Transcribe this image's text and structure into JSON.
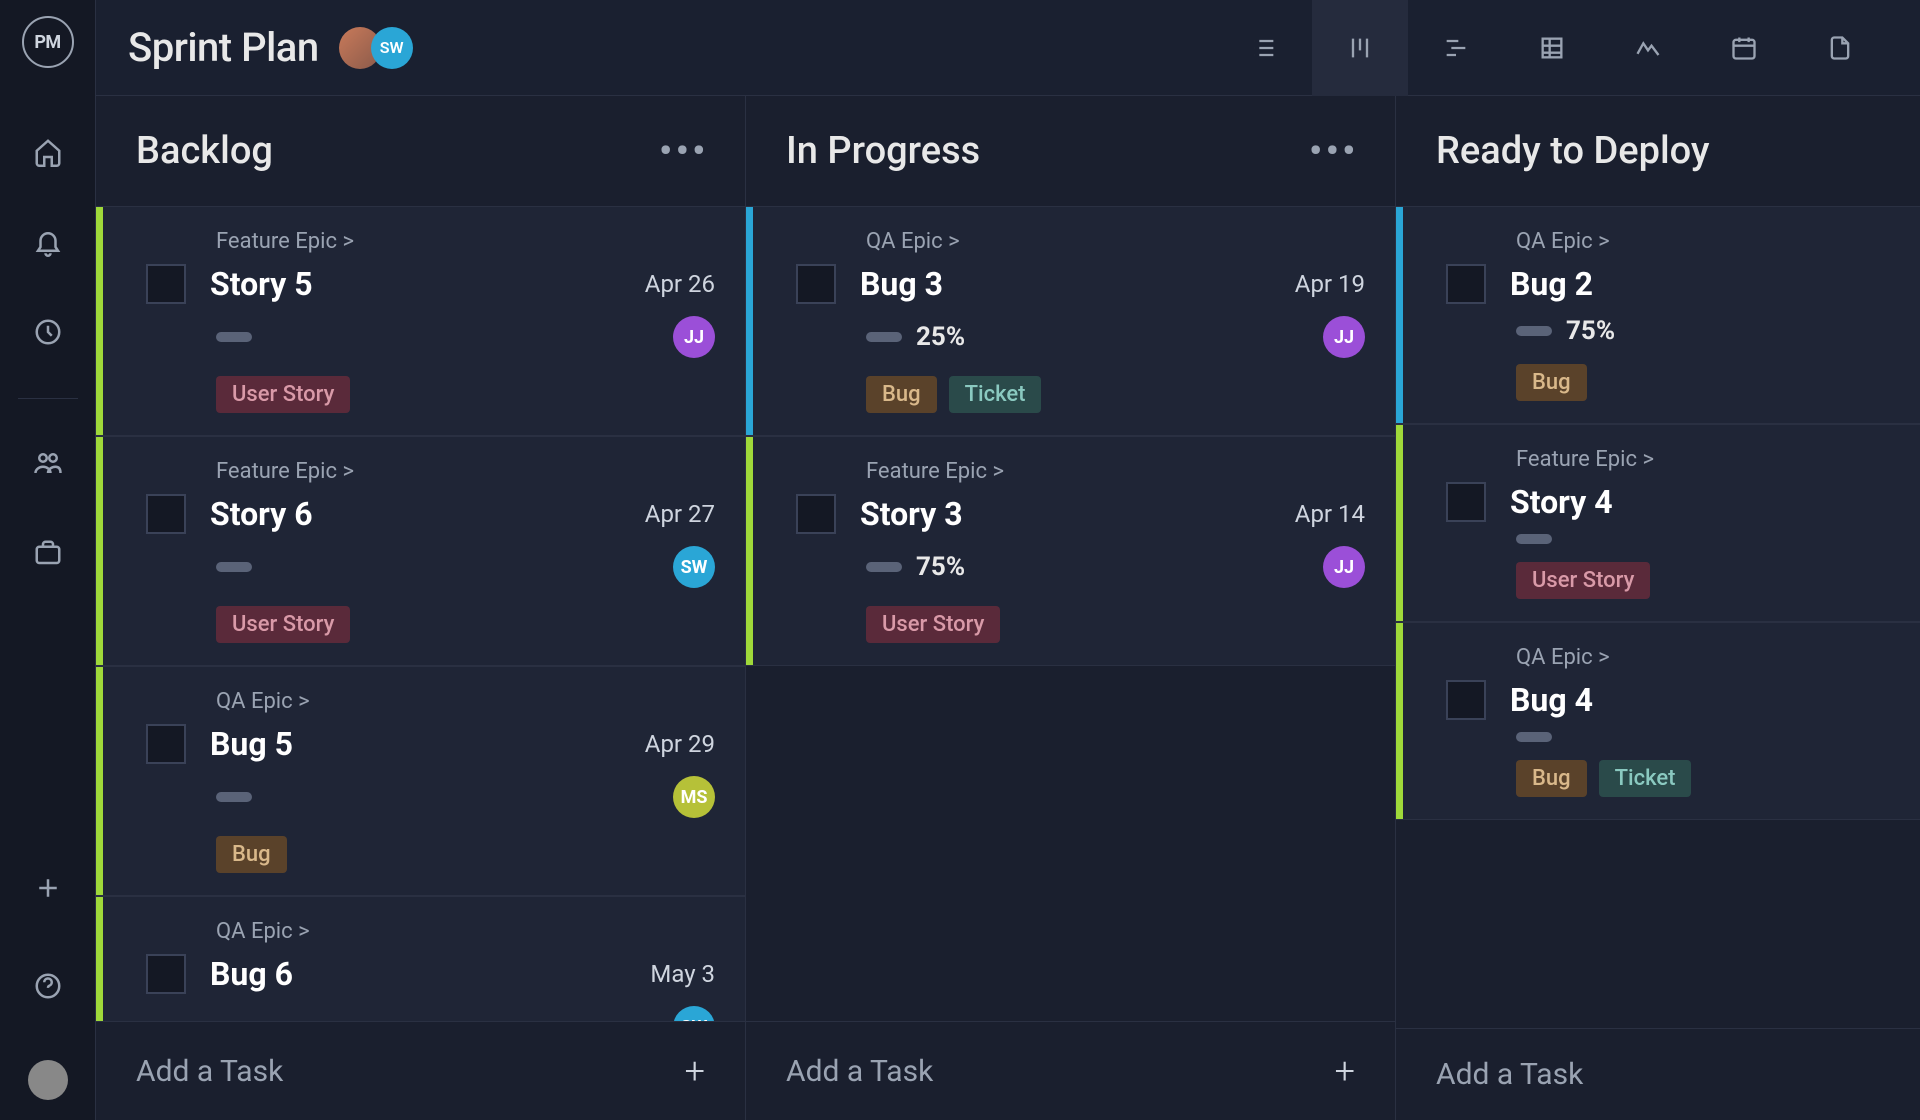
{
  "app": {
    "logo_text": "PM"
  },
  "header": {
    "project_title": "Sprint Plan",
    "avatars": [
      {
        "initials": "",
        "class": "av-photo"
      },
      {
        "initials": "SW",
        "class": "av-sw"
      }
    ]
  },
  "view_tabs": [
    {
      "name": "list-view",
      "active": false
    },
    {
      "name": "board-view",
      "active": true
    },
    {
      "name": "gantt-view",
      "active": false
    },
    {
      "name": "sheet-view",
      "active": false
    },
    {
      "name": "dashboard-view",
      "active": false
    },
    {
      "name": "calendar-view",
      "active": false
    },
    {
      "name": "files-view",
      "active": false
    }
  ],
  "columns": [
    {
      "title": "Backlog",
      "show_menu": true,
      "show_add_plus": true,
      "add_task_label": "Add a Task",
      "cards": [
        {
          "epic": "Feature Epic >",
          "title": "Story 5",
          "date": "Apr 26",
          "progress_pct": "",
          "assignee": {
            "initials": "JJ",
            "class": "av-jj"
          },
          "tags": [
            {
              "label": "User Story",
              "class": "tag-userstory"
            }
          ],
          "stripe": "stripe-lime"
        },
        {
          "epic": "Feature Epic >",
          "title": "Story 6",
          "date": "Apr 27",
          "progress_pct": "",
          "assignee": {
            "initials": "SW",
            "class": "av-sw"
          },
          "tags": [
            {
              "label": "User Story",
              "class": "tag-userstory"
            }
          ],
          "stripe": "stripe-lime"
        },
        {
          "epic": "QA Epic >",
          "title": "Bug 5",
          "date": "Apr 29",
          "progress_pct": "",
          "assignee": {
            "initials": "MS",
            "class": "av-ms"
          },
          "tags": [
            {
              "label": "Bug",
              "class": "tag-bug"
            }
          ],
          "stripe": "stripe-lime"
        },
        {
          "epic": "QA Epic >",
          "title": "Bug 6",
          "date": "May 3",
          "progress_pct": "",
          "assignee": {
            "initials": "SW",
            "class": "av-sw"
          },
          "tags": [],
          "stripe": "stripe-lime"
        }
      ]
    },
    {
      "title": "In Progress",
      "show_menu": true,
      "show_add_plus": true,
      "add_task_label": "Add a Task",
      "cards": [
        {
          "epic": "QA Epic >",
          "title": "Bug 3",
          "date": "Apr 19",
          "progress_pct": "25%",
          "assignee": {
            "initials": "JJ",
            "class": "av-jj"
          },
          "tags": [
            {
              "label": "Bug",
              "class": "tag-bug"
            },
            {
              "label": "Ticket",
              "class": "tag-ticket"
            }
          ],
          "stripe": "stripe-cyan"
        },
        {
          "epic": "Feature Epic >",
          "title": "Story 3",
          "date": "Apr 14",
          "progress_pct": "75%",
          "assignee": {
            "initials": "JJ",
            "class": "av-jj"
          },
          "tags": [
            {
              "label": "User Story",
              "class": "tag-userstory"
            }
          ],
          "stripe": "stripe-lime"
        }
      ]
    },
    {
      "title": "Ready to Deploy",
      "show_menu": false,
      "show_add_plus": false,
      "add_task_label": "Add a Task",
      "cards": [
        {
          "epic": "QA Epic >",
          "title": "Bug 2",
          "date": "",
          "progress_pct": "75%",
          "assignee": null,
          "tags": [
            {
              "label": "Bug",
              "class": "tag-bug"
            }
          ],
          "stripe": "stripe-cyan"
        },
        {
          "epic": "Feature Epic >",
          "title": "Story 4",
          "date": "",
          "progress_pct": "",
          "assignee": null,
          "tags": [
            {
              "label": "User Story",
              "class": "tag-userstory"
            }
          ],
          "stripe": "stripe-lime"
        },
        {
          "epic": "QA Epic >",
          "title": "Bug 4",
          "date": "",
          "progress_pct": "",
          "assignee": null,
          "tags": [
            {
              "label": "Bug",
              "class": "tag-bug"
            },
            {
              "label": "Ticket",
              "class": "tag-ticket"
            }
          ],
          "stripe": "stripe-lime"
        }
      ]
    }
  ]
}
